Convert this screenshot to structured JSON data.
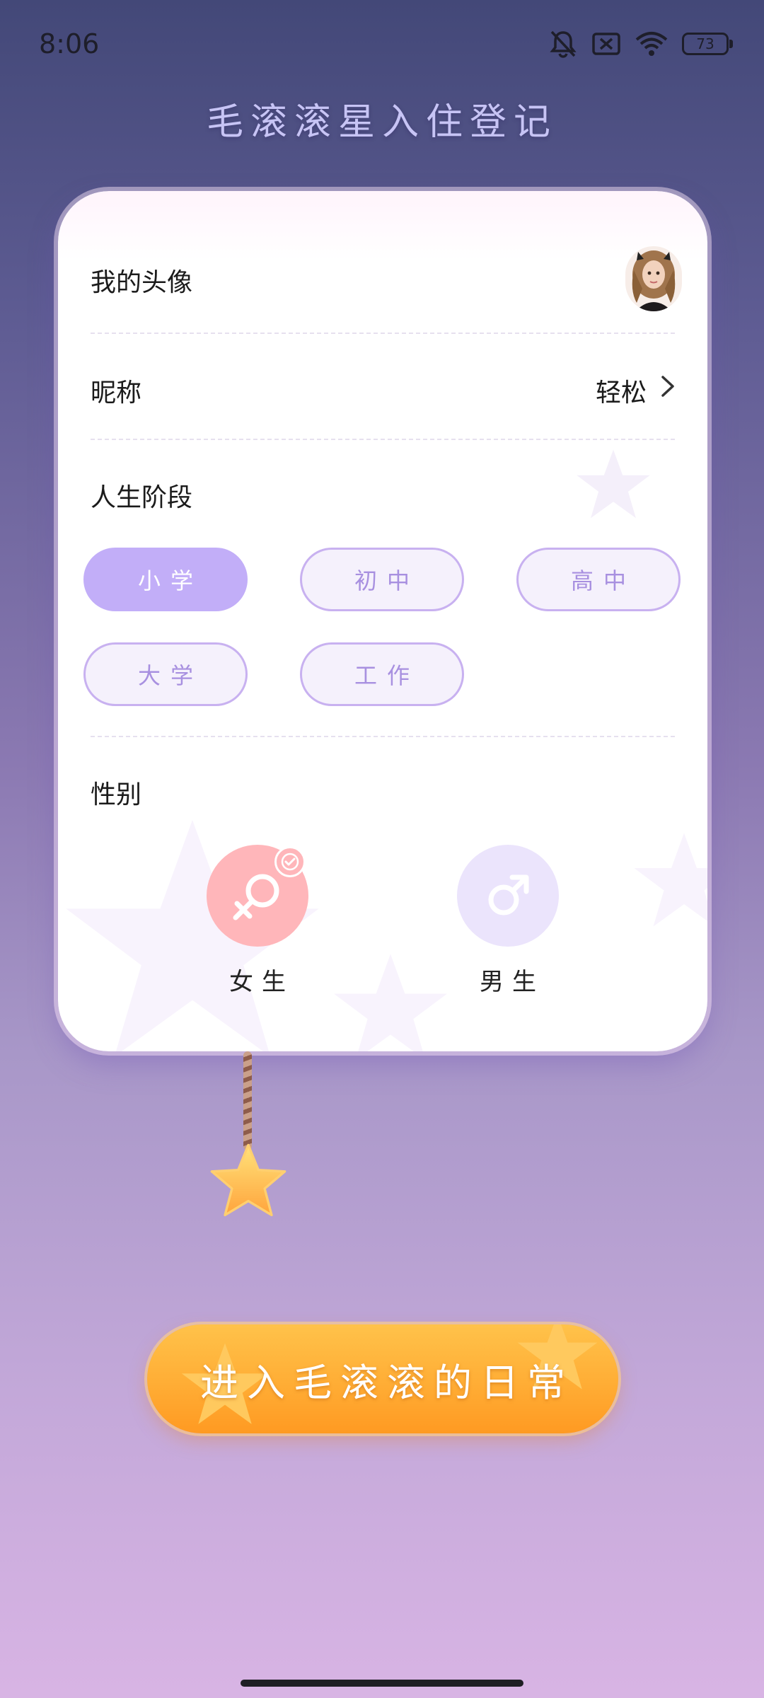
{
  "status_bar": {
    "time": "8:06",
    "battery_level": "73",
    "icons": [
      "bell-muted-icon",
      "sim-off-icon",
      "wifi-icon",
      "battery-icon"
    ]
  },
  "page_title": "毛滚滚星入住登记",
  "form": {
    "avatar_label": "我的头像",
    "nickname_label": "昵称",
    "nickname_value": "轻松",
    "life_stage_label": "人生阶段",
    "life_stages": [
      {
        "label": "小学",
        "selected": true
      },
      {
        "label": "初中",
        "selected": false
      },
      {
        "label": "高中",
        "selected": false
      },
      {
        "label": "大学",
        "selected": false
      },
      {
        "label": "工作",
        "selected": false
      }
    ],
    "gender_label": "性别",
    "genders": [
      {
        "label": "女生",
        "icon": "female-icon",
        "selected": true
      },
      {
        "label": "男生",
        "icon": "male-icon",
        "selected": false
      }
    ]
  },
  "cta_label": "进入毛滚滚的日常",
  "colors": {
    "accent_purple": "#c2aef8",
    "female_pink": "#ffb6ba",
    "cta_orange": "#ffad35"
  }
}
